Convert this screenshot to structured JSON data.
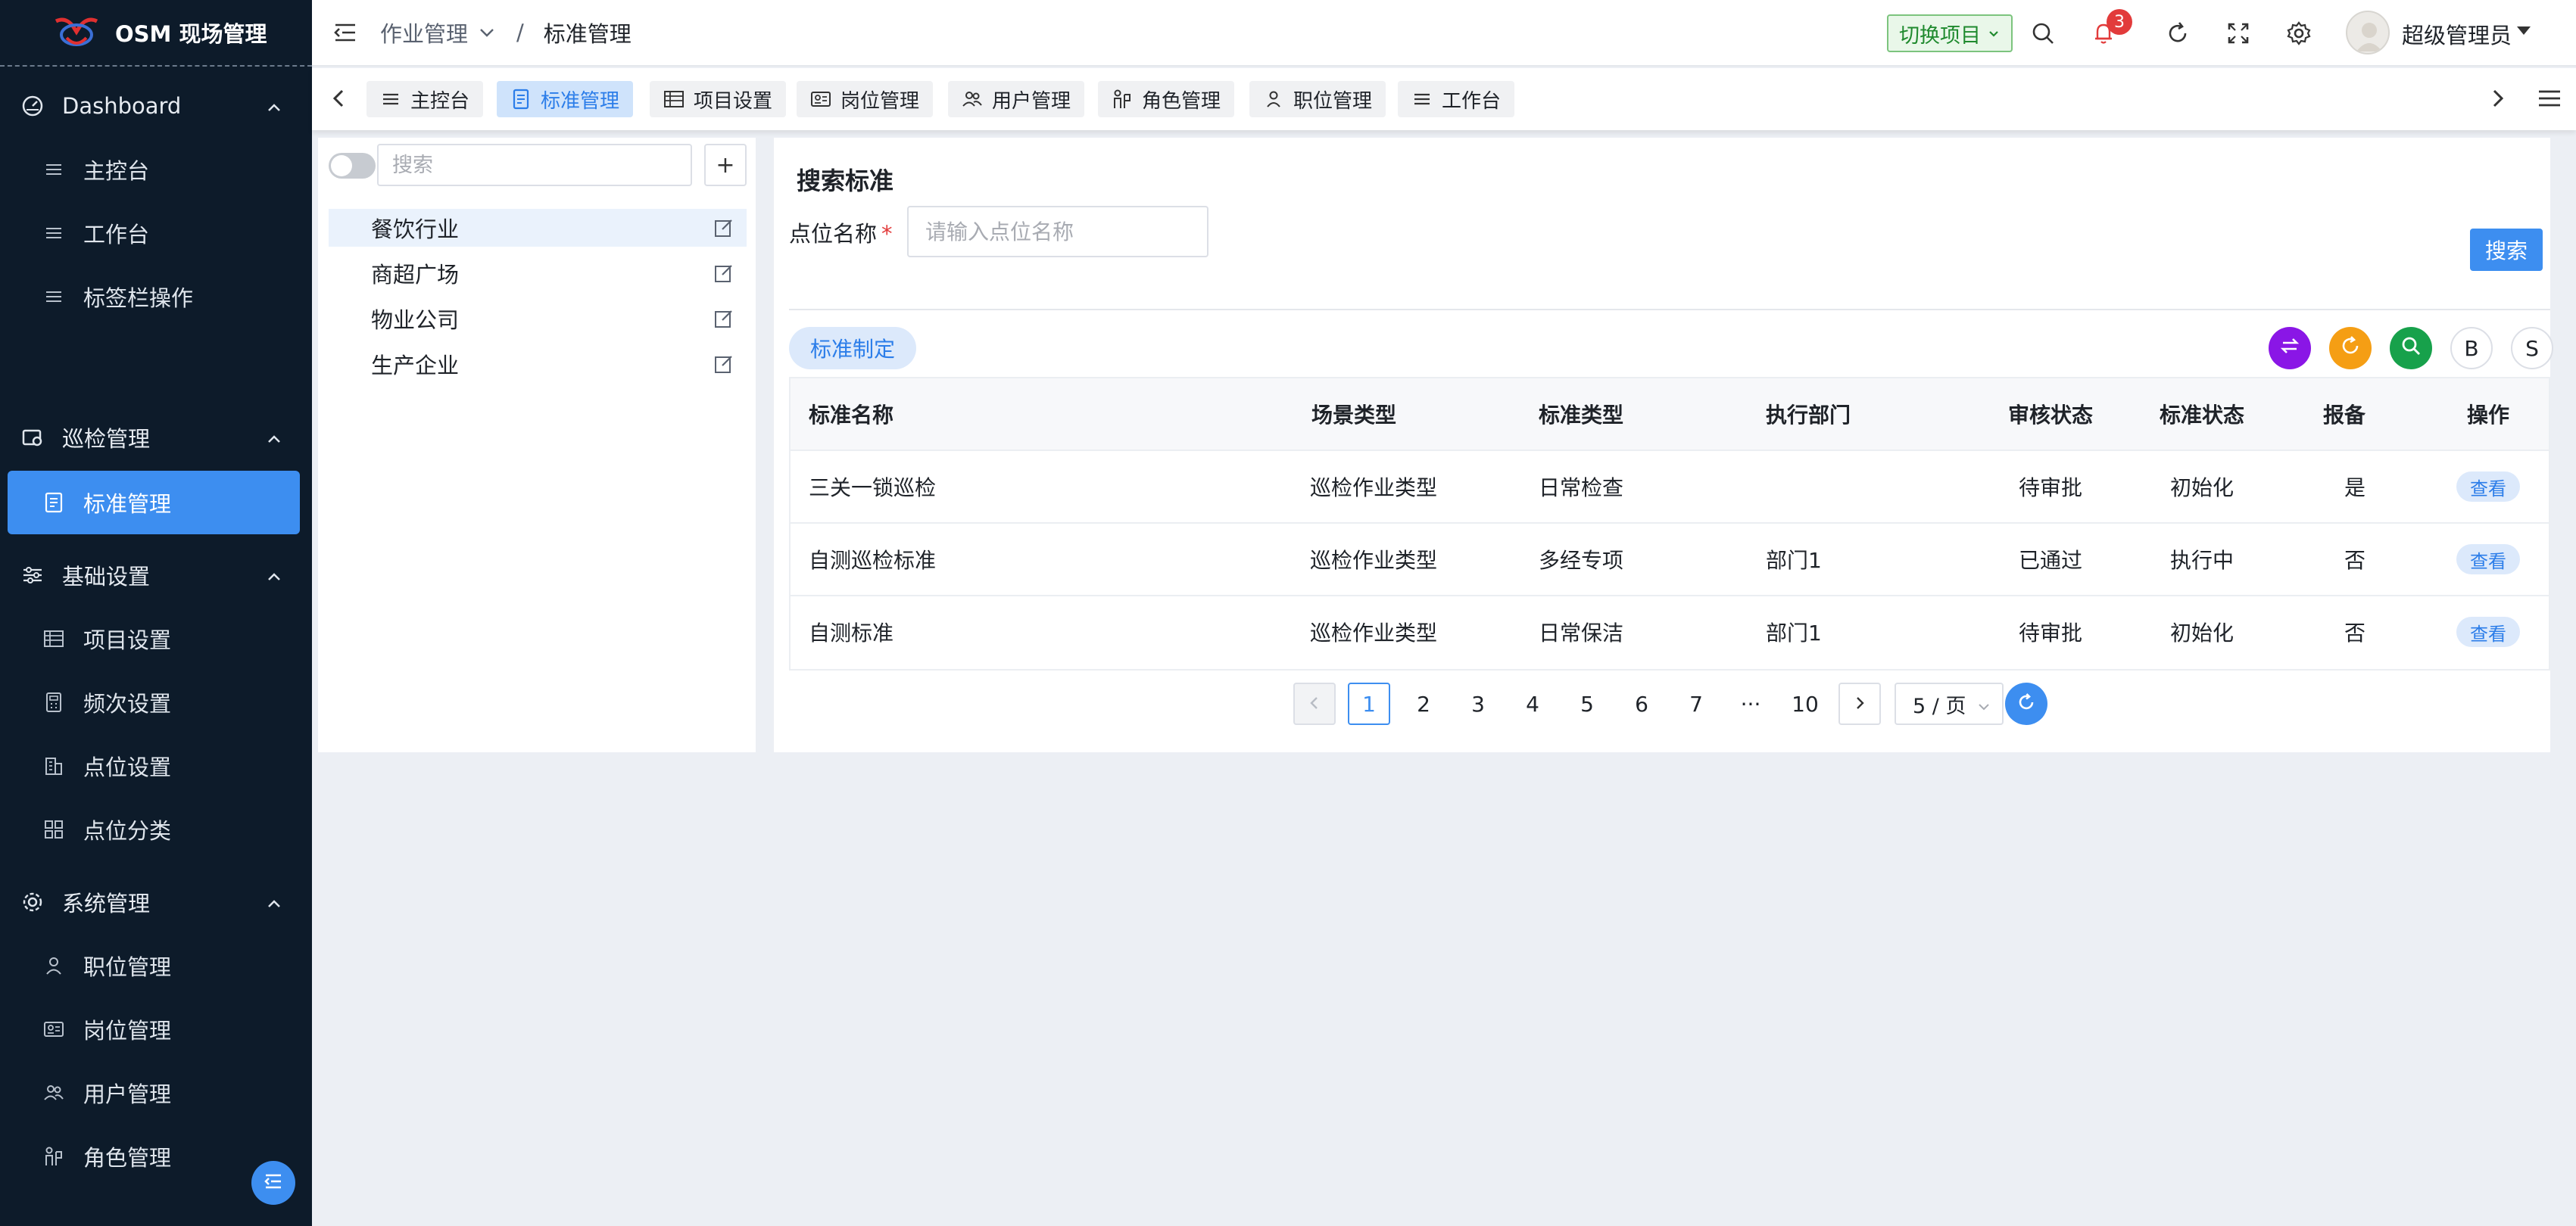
{
  "app": {
    "title": "OSM 现场管理"
  },
  "sidebar": {
    "groups": [
      {
        "label": "Dashboard",
        "icon": "dashboard-icon"
      },
      {
        "label": "巡检管理",
        "icon": "inspection-icon"
      },
      {
        "label": "基础设置",
        "icon": "sliders-icon"
      },
      {
        "label": "系统管理",
        "icon": "gear-icon"
      }
    ],
    "items": [
      {
        "label": "主控台",
        "icon": "list-icon"
      },
      {
        "label": "工作台",
        "icon": "list-icon"
      },
      {
        "label": "标签栏操作",
        "icon": "list-icon"
      },
      {
        "label": "标准管理",
        "icon": "document-icon",
        "active": true
      },
      {
        "label": "项目设置",
        "icon": "table-icon"
      },
      {
        "label": "频次设置",
        "icon": "calculator-icon"
      },
      {
        "label": "点位设置",
        "icon": "building-icon"
      },
      {
        "label": "点位分类",
        "icon": "grid-icon"
      },
      {
        "label": "职位管理",
        "icon": "user-icon"
      },
      {
        "label": "岗位管理",
        "icon": "id-card-icon"
      },
      {
        "label": "用户管理",
        "icon": "users-icon"
      },
      {
        "label": "角色管理",
        "icon": "role-icon"
      }
    ]
  },
  "header": {
    "breadcrumb": [
      "作业管理",
      "/",
      "标准管理"
    ],
    "switch_project": "切换项目",
    "notification_count": "3",
    "user_name": "超级管理员"
  },
  "tabs": [
    {
      "label": "主控台",
      "icon": "list-icon"
    },
    {
      "label": "标准管理",
      "icon": "document-icon",
      "active": true
    },
    {
      "label": "项目设置",
      "icon": "table-icon"
    },
    {
      "label": "岗位管理",
      "icon": "id-card-icon"
    },
    {
      "label": "用户管理",
      "icon": "users-icon"
    },
    {
      "label": "角色管理",
      "icon": "role-icon"
    },
    {
      "label": "职位管理",
      "icon": "user-icon"
    },
    {
      "label": "工作台",
      "icon": "list-icon"
    }
  ],
  "tree": {
    "search_placeholder": "搜索",
    "add_label": "+",
    "nodes": [
      "餐饮行业",
      "商超广场",
      "物业公司",
      "生产企业"
    ]
  },
  "main": {
    "title": "搜索标准",
    "field_label": "点位名称",
    "required_mark": "*",
    "field_placeholder": "请输入点位名称",
    "search_button": "搜索",
    "create_button": "标准制定",
    "toolbar_b": "B",
    "toolbar_s": "S",
    "table": {
      "headers": [
        "标准名称",
        "场景类型",
        "标准类型",
        "执行部门",
        "审核状态",
        "标准状态",
        "报备",
        "操作"
      ],
      "rows": [
        [
          "三关一锁巡检",
          "巡检作业类型",
          "日常检查",
          "",
          "待审批",
          "初始化",
          "是",
          "查看"
        ],
        [
          "自测巡检标准",
          "巡检作业类型",
          "多经专项",
          "部门1",
          "已通过",
          "执行中",
          "否",
          "查看"
        ],
        [
          "自测标准",
          "巡检作业类型",
          "日常保洁",
          "部门1",
          "待审批",
          "初始化",
          "否",
          "查看"
        ]
      ]
    },
    "pagination": {
      "pages": [
        "1",
        "2",
        "3",
        "4",
        "5",
        "6",
        "7",
        "···",
        "10"
      ],
      "current": "1",
      "page_size": "5 / 页"
    }
  },
  "colors": {
    "sidebar_bg": "#0d1b2a",
    "accent": "#3d8ef0",
    "purple": "#8a16e6",
    "orange": "#f59e14",
    "green": "#17a14b"
  }
}
